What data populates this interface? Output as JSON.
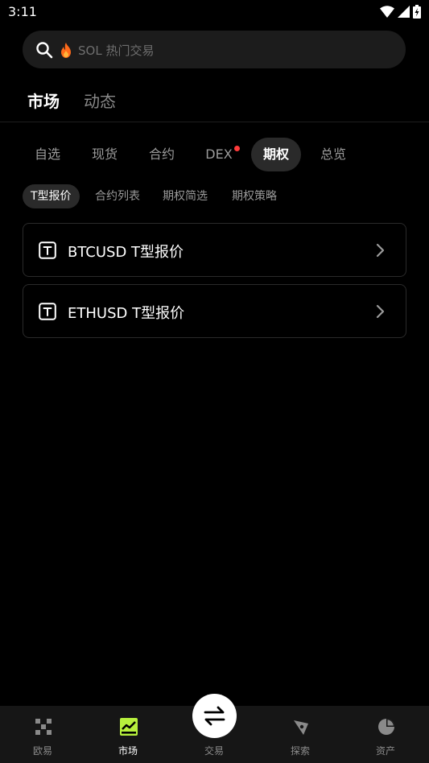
{
  "status_bar": {
    "time": "3:11"
  },
  "search": {
    "placeholder": "SOL 热门交易"
  },
  "primary_tabs": [
    {
      "label": "市场"
    },
    {
      "label": "动态"
    }
  ],
  "category_tabs": [
    {
      "label": "自选"
    },
    {
      "label": "现货"
    },
    {
      "label": "合约"
    },
    {
      "label": "DEX"
    },
    {
      "label": "期权"
    },
    {
      "label": "总览"
    }
  ],
  "sub_tabs": [
    {
      "label": "T型报价"
    },
    {
      "label": "合约列表"
    },
    {
      "label": "期权简选"
    },
    {
      "label": "期权策略"
    }
  ],
  "options": [
    {
      "label": "BTCUSD T型报价",
      "icon": "t-box-icon"
    },
    {
      "label": "ETHUSD T型报价",
      "icon": "t-box-icon"
    }
  ],
  "bottom_nav": [
    {
      "label": "欧易",
      "icon": "okx-logo-icon"
    },
    {
      "label": "市场",
      "icon": "market-chart-icon"
    },
    {
      "label": "交易",
      "icon": "swap-arrows-icon"
    },
    {
      "label": "探索",
      "icon": "compass-icon"
    },
    {
      "label": "资产",
      "icon": "pie-chart-icon"
    }
  ],
  "colors": {
    "accent": "#b7f03d",
    "notification": "#ff3b3b",
    "background": "#000000"
  }
}
